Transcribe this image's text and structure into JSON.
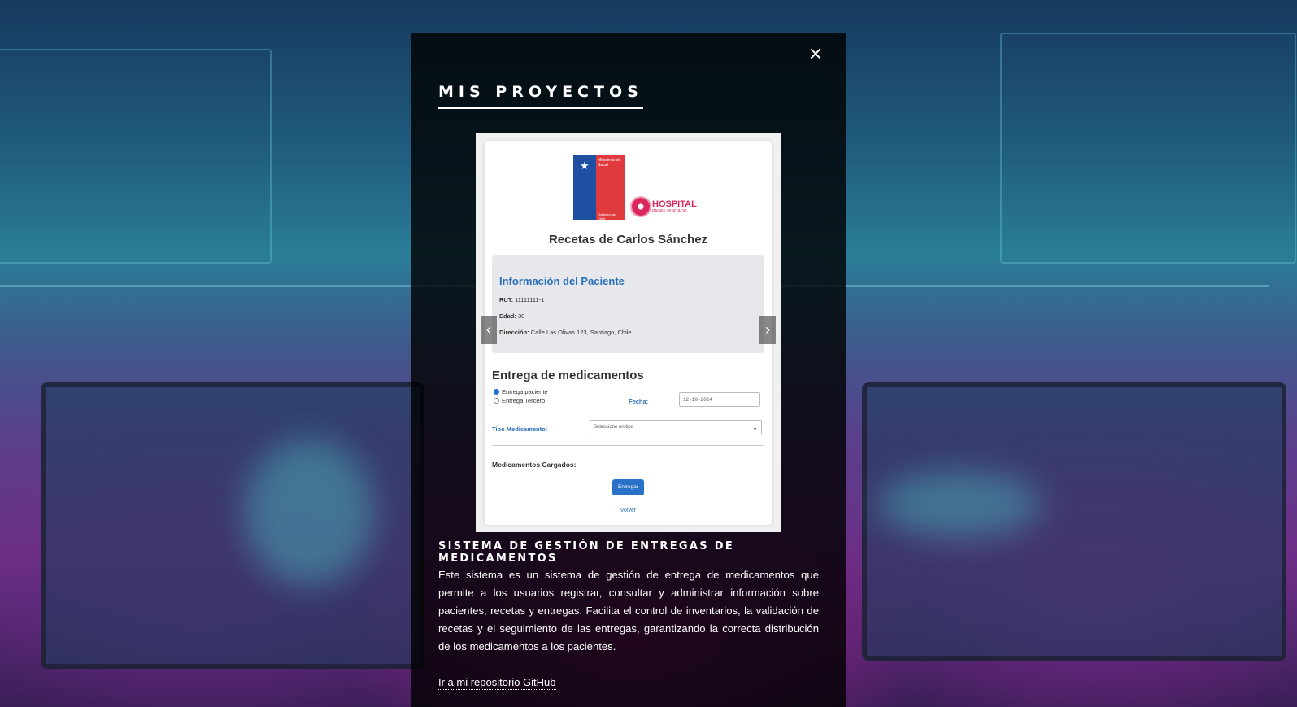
{
  "modal": {
    "title": "MIS PROYECTOS",
    "close_icon": "close-icon",
    "carousel": {
      "prev_icon": "chevron-left-icon",
      "next_icon": "chevron-right-icon",
      "prev_glyph": "‹",
      "next_glyph": "›",
      "slide": {
        "logo_minsal_line1": "Ministerio de Salud",
        "logo_minsal_line2": "Gobierno de Chile",
        "logo_hospital_name": "HOSPITAL",
        "logo_hospital_sub": "PADRE HURTADO",
        "title": "Recetas de Carlos Sánchez",
        "patient_info_title": "Información del Paciente",
        "rut_label": "RUT:",
        "rut_value": "11111111-1",
        "edad_label": "Edad:",
        "edad_value": "30",
        "direccion_label": "Dirección:",
        "direccion_value": "Calle Las Olivas 123, Santiago, Chile",
        "entrega_title": "Entrega de medicamentos",
        "radio_paciente": "Entrega paciente",
        "radio_tercero": "Entrega Tercero",
        "fecha_label": "Fecha:",
        "fecha_value": "12-10-2024",
        "tipo_label": "Tipo Medicamento:",
        "tipo_value": "Seleccione un tipo",
        "cargados_label": "Medicamentos Cargados:",
        "entregar_button": "Entregar",
        "volver_link": "Volver"
      }
    },
    "project_title": "SISTEMA DE GESTIÓN DE ENTREGAS DE MEDICAMENTOS",
    "project_description": "Este sistema es un sistema de gestión de entrega de medicamentos que permite a los usuarios registrar, consultar y administrar información sobre pacientes, recetas y entregas. Facilita el control de inventarios, la validación de recetas y el seguimiento de las entregas, garantizando la correcta distribución de los medicamentos a los pacientes.",
    "repo_link": "Ir a mi repositorio GitHub"
  },
  "colors": {
    "overlay": "#000000",
    "link_blue": "#2a6fb8",
    "button_blue": "#2a72c8",
    "hospital_pink": "#d8285c"
  }
}
